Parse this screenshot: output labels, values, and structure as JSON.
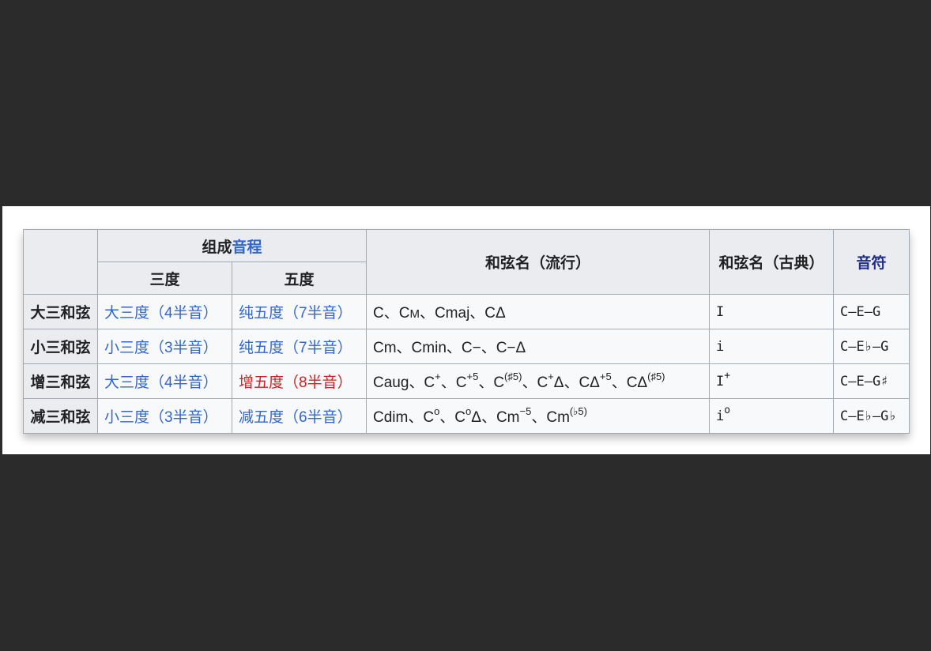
{
  "header": {
    "composition_prefix": "组成",
    "composition_link": "音程",
    "third": "三度",
    "fifth": "五度",
    "popular": "和弦名（流行）",
    "classical": "和弦名（古典）",
    "notes": "音符"
  },
  "rows": [
    {
      "name": "大三和弦",
      "third": "大三度（4半音）",
      "fifth": "纯五度（7半音）",
      "popular": [
        {
          "t": "C、C"
        },
        {
          "t": "M"
        },
        {
          "t": "、Cmaj、CΔ"
        }
      ],
      "classical": [
        {
          "t": "I"
        }
      ],
      "notes": "C–E–G"
    },
    {
      "name": "小三和弦",
      "third": "小三度（3半音）",
      "fifth": "纯五度（7半音）",
      "popular": [
        {
          "t": "Cm、Cmin、C−、C−Δ"
        }
      ],
      "classical": [
        {
          "t": "i"
        }
      ],
      "notes": "C–E♭–G"
    },
    {
      "name": "增三和弦",
      "third": "大三度（4半音）",
      "fifth": "增五度（8半音）",
      "popular": [
        {
          "t": "Caug、C"
        },
        {
          "t": "+"
        },
        {
          "t": "、C"
        },
        {
          "t": "+5"
        },
        {
          "t": "、C"
        },
        {
          "t": "(♯5)"
        },
        {
          "t": "、C"
        },
        {
          "t": "+"
        },
        {
          "t": "Δ、CΔ"
        },
        {
          "t": "+5"
        },
        {
          "t": "、CΔ"
        },
        {
          "t": "(♯5)"
        }
      ],
      "classical": [
        {
          "t": "I"
        },
        {
          "t": "+"
        }
      ],
      "notes": "C–E–G♯"
    },
    {
      "name": "减三和弦",
      "third": "小三度（3半音）",
      "fifth": "减五度（6半音）",
      "popular": [
        {
          "t": "Cdim、C"
        },
        {
          "t": "o"
        },
        {
          "t": "、C"
        },
        {
          "t": "o"
        },
        {
          "t": "Δ、Cm"
        },
        {
          "t": "−5"
        },
        {
          "t": "、Cm"
        },
        {
          "t": "(♭5)"
        }
      ],
      "classical": [
        {
          "t": "i"
        },
        {
          "t": "o"
        }
      ],
      "notes": "C–E♭–G♭"
    }
  ]
}
